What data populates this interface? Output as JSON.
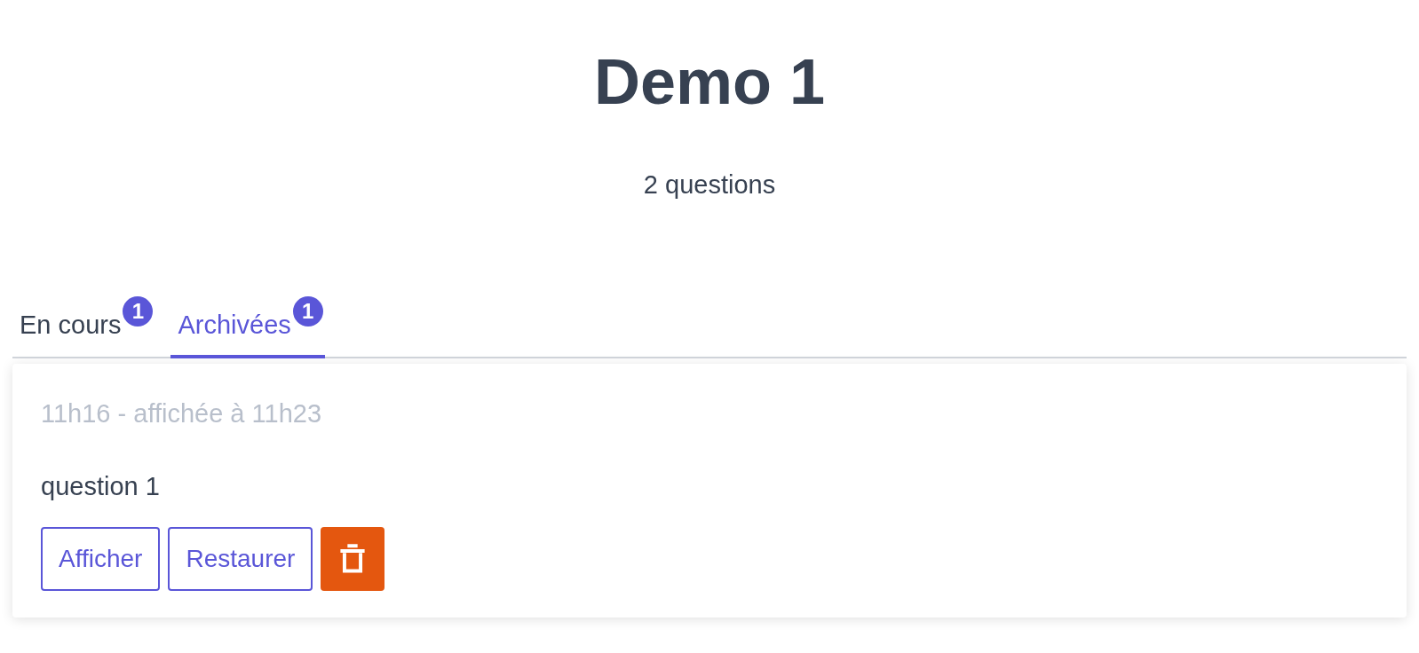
{
  "title": "Demo 1",
  "subtitle": "2 questions",
  "tabs": [
    {
      "label": "En cours",
      "count": "1",
      "selected": false
    },
    {
      "label": "Archivées",
      "count": "1",
      "selected": true
    }
  ],
  "questions": [
    {
      "meta": "11h16 - affichée à 11h23",
      "text": "question 1",
      "actions": [
        {
          "kind": "outline",
          "label": "Afficher"
        },
        {
          "kind": "outline",
          "label": "Restaurer"
        },
        {
          "kind": "delete"
        }
      ]
    }
  ]
}
